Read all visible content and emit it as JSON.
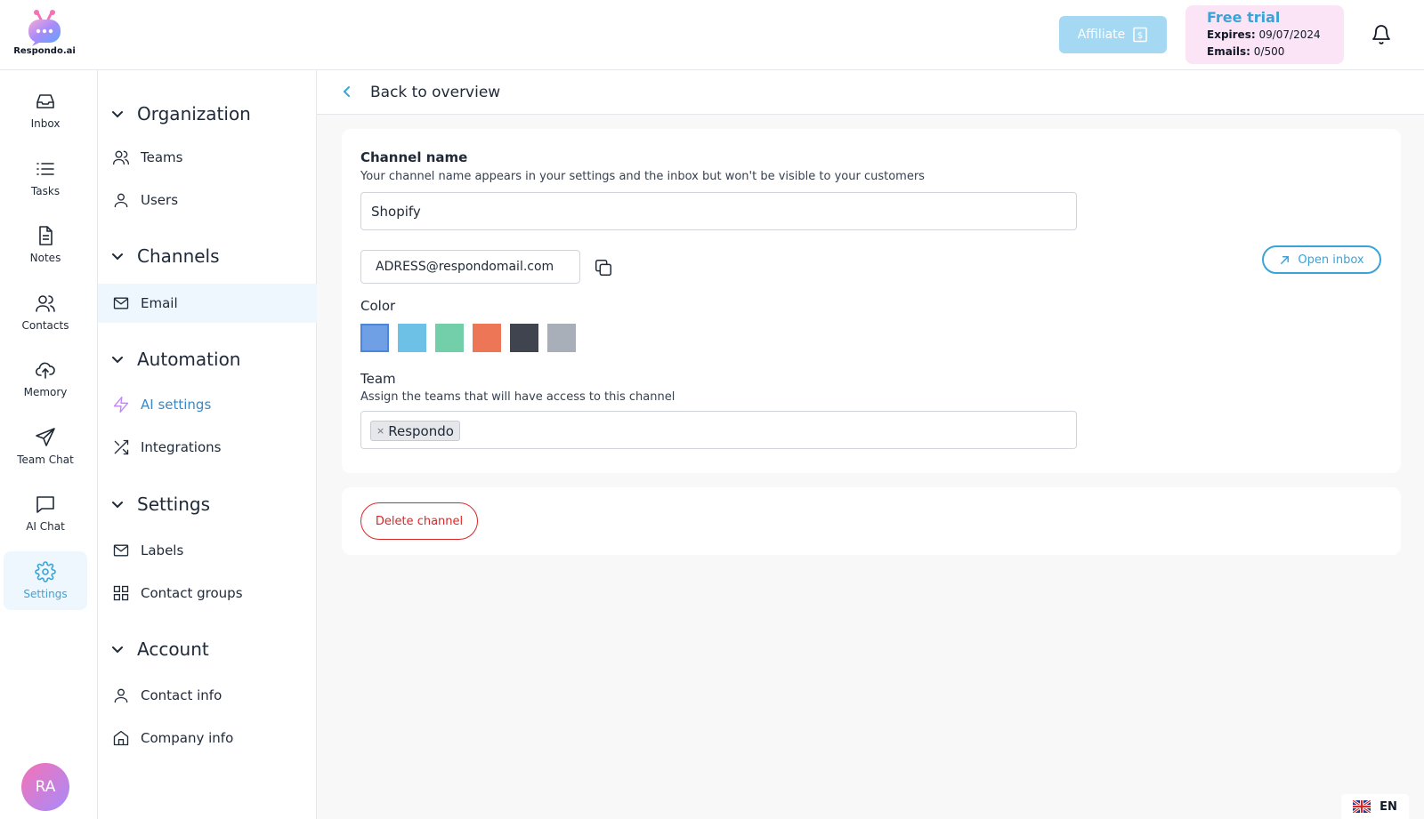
{
  "brand": {
    "name": "Respondo.ai"
  },
  "header": {
    "affiliate_label": "Affiliate",
    "trial": {
      "title": "Free trial",
      "expires_label": "Expires:",
      "expires_value": "09/07/2024",
      "emails_label": "Emails:",
      "emails_value": "0/500"
    }
  },
  "rail": {
    "items": [
      {
        "label": "Inbox",
        "icon": "inbox-icon"
      },
      {
        "label": "Tasks",
        "icon": "list-icon"
      },
      {
        "label": "Notes",
        "icon": "document-icon"
      },
      {
        "label": "Contacts",
        "icon": "users-icon"
      },
      {
        "label": "Memory",
        "icon": "cloud-upload-icon"
      },
      {
        "label": "Team Chat",
        "icon": "send-icon"
      },
      {
        "label": "AI Chat",
        "icon": "chat-icon"
      },
      {
        "label": "Settings",
        "icon": "gear-icon"
      }
    ],
    "active": "Settings",
    "avatar_initials": "RA"
  },
  "sidebar": {
    "sections": [
      {
        "title": "Organization",
        "items": [
          {
            "label": "Teams"
          },
          {
            "label": "Users"
          }
        ]
      },
      {
        "title": "Channels",
        "items": [
          {
            "label": "Email"
          }
        ]
      },
      {
        "title": "Automation",
        "items": [
          {
            "label": "AI settings"
          },
          {
            "label": "Integrations"
          }
        ]
      },
      {
        "title": "Settings",
        "items": [
          {
            "label": "Labels"
          },
          {
            "label": "Contact groups"
          }
        ]
      },
      {
        "title": "Account",
        "items": [
          {
            "label": "Contact info"
          },
          {
            "label": "Company info"
          }
        ]
      }
    ],
    "active_item": "Email"
  },
  "main": {
    "back_label": "Back to overview",
    "channel_name_label": "Channel name",
    "channel_name_desc": "Your channel name appears in your settings and the inbox but won't be visible to your customers",
    "channel_name_value": "Shopify",
    "email_address": "ADRESS@respondomail.com",
    "open_inbox_label": "Open inbox",
    "color_label": "Color",
    "colors": [
      "#6fa0e6",
      "#6ec1e6",
      "#72cfa9",
      "#ec7655",
      "#3f444e",
      "#a9afb8"
    ],
    "selected_color": "#6fa0e6",
    "team_label": "Team",
    "team_desc": "Assign the teams that will have access to this channel",
    "team_tags": [
      "Respondo"
    ],
    "delete_label": "Delete channel"
  },
  "language": {
    "code": "EN"
  },
  "colors": {
    "accent": "#3aa3d8",
    "danger": "#dc2626",
    "trial_bg": "#fbe4f6",
    "affiliate_bg": "#a5d9f3"
  }
}
